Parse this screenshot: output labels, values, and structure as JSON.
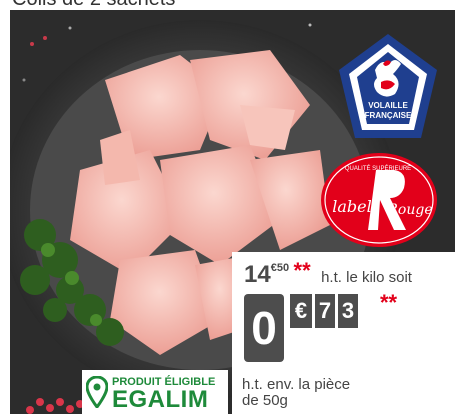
{
  "caption": {
    "text": "Colis de 2 sachets"
  },
  "badges": {
    "volaille": {
      "line1": "VOLAILLE",
      "line2": "FRANÇAISE",
      "color": "#1f3f8f",
      "accent": "#e2001a"
    },
    "label_rouge": {
      "script_left": "label",
      "script_right": "Rouge",
      "top_text": "QUALITÉ SUPÉRIEURE",
      "color": "#e2001a"
    }
  },
  "price": {
    "kilo_int": "14",
    "kilo_dec": "€50",
    "kilo_stars": "**",
    "kilo_suffix": "h.t. le kilo soit",
    "unit_int": "0",
    "unit_currency": "€",
    "unit_dec1": "7",
    "unit_dec2": "3",
    "unit_stars": "**",
    "note_line1": "h.t. env. la pièce",
    "note_line2": "de 50g"
  },
  "egalim": {
    "top": "PRODUIT ÉLIGIBLE",
    "main": "EGALIM",
    "color": "#1e8a3a"
  }
}
